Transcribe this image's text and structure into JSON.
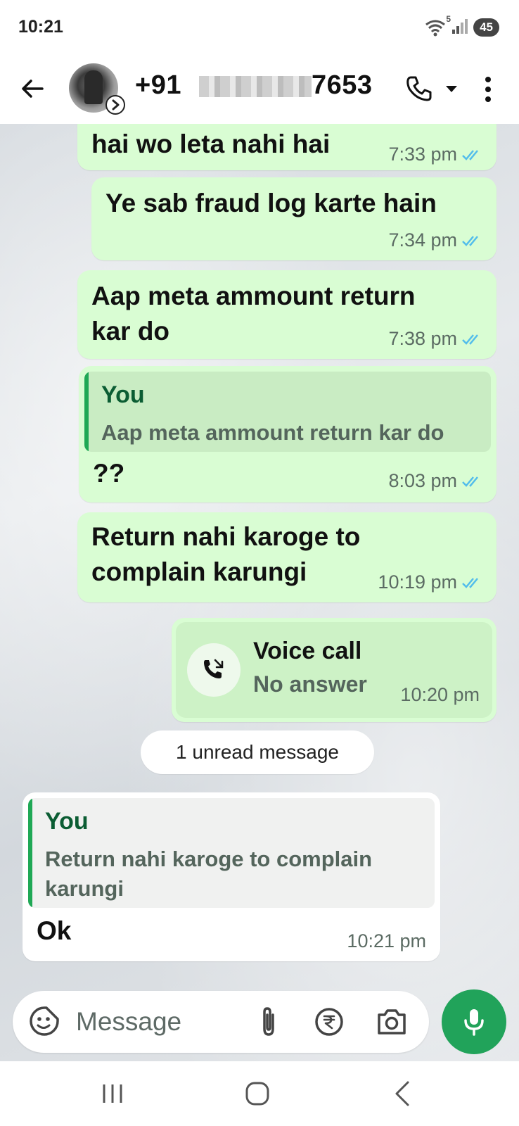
{
  "status_bar": {
    "time": "10:21",
    "battery": "45",
    "wifi_badge": "5"
  },
  "header": {
    "phone_prefix": "+91",
    "phone_suffix": "7653"
  },
  "messages": [
    {
      "text": "hai wo leta nahi hai",
      "time": "7:33 pm"
    },
    {
      "text": "Ye sab fraud log karte hain",
      "time": "7:34 pm"
    },
    {
      "text": "Aap meta ammount return kar do",
      "time": "7:38 pm"
    },
    {
      "quote_author": "You",
      "quote_text": "Aap meta ammount return kar do",
      "text": "??",
      "time": "8:03 pm"
    },
    {
      "text": "Return nahi karoge to complain karungi",
      "time": "10:19 pm"
    }
  ],
  "call": {
    "title": "Voice call",
    "subtitle": "No answer",
    "time": "10:20 pm"
  },
  "unread": "1 unread message",
  "incoming": {
    "quote_author": "You",
    "quote_text": "Return nahi karoge to complain karungi",
    "text": "Ok",
    "time": "10:21 pm"
  },
  "composer": {
    "placeholder": "Message"
  },
  "colors": {
    "outgoing_bubble": "#d9fdd3",
    "incoming_bubble": "#ffffff",
    "accent_green": "#21a35a",
    "read_ticks": "#53bdeb"
  },
  "icons": [
    "back-arrow-icon",
    "status-ring-icon",
    "phone-icon",
    "dropdown-caret-icon",
    "more-vert-icon",
    "missed-call-icon",
    "sticker-icon",
    "attach-icon",
    "rupee-icon",
    "camera-icon",
    "mic-icon"
  ]
}
